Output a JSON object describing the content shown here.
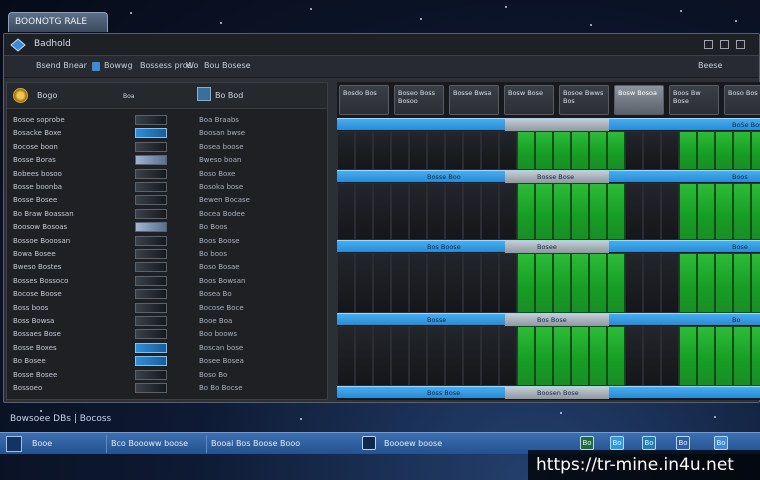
{
  "tab": {
    "label": "BOONOTG RALE"
  },
  "window": {
    "title": "Badhold",
    "toolbar": [
      "Bsend Bnear",
      "Bowwg",
      "Bossess pros",
      "Wo",
      "Bou Bosese"
    ],
    "toolbar_right": "Beese"
  },
  "left_panel": {
    "header": [
      {
        "name": "Bogo",
        "sub": "Boa"
      },
      {
        "name": "Bo Bod"
      }
    ],
    "rows": [
      {
        "label": "Bosoe soprobe",
        "meta": "Boa Braabs"
      },
      {
        "label": "Bosacke Boxe",
        "meta": "Boosan bwse"
      },
      {
        "label": "Bocose boon",
        "meta": "Bosea boose"
      },
      {
        "label": "Bosse Boras",
        "meta": "Bweso boan"
      },
      {
        "label": "Bobees bosoo",
        "meta": "Boso Boxe"
      },
      {
        "label": "Bosse boonba",
        "meta": "Bosoka bose"
      },
      {
        "label": "Bosse Bosee",
        "meta": "Bewen Bocase"
      },
      {
        "label": "Bo Braw Boassan",
        "meta": "Bocea Bodee"
      },
      {
        "label": "Boosow Bosoas",
        "meta": "Bo Boos"
      },
      {
        "label": "Bossoe Booosan",
        "meta": "Boos Boose"
      },
      {
        "label": "Bowa Bosee",
        "meta": "Bo boos"
      },
      {
        "label": "Bweso Bostes",
        "meta": "Boso Bosae"
      },
      {
        "label": "Bosses Bossoco",
        "meta": "Boos Bowsan"
      },
      {
        "label": "Bocose Boose",
        "meta": "Bosea Bo"
      },
      {
        "label": "Boss boos",
        "meta": "Bocose Boce"
      },
      {
        "label": "Boss Bowsa",
        "meta": "Booe Boa"
      },
      {
        "label": "Bossaes Bose",
        "meta": "Boo boows"
      },
      {
        "label": "Bosse Boxes",
        "meta": "Boscan bose"
      },
      {
        "label": "Bo Bosee",
        "meta": "Bosee Bosea"
      },
      {
        "label": "Bosse Bosee",
        "meta": "Boso Bo"
      },
      {
        "label": "Bossoeo",
        "meta": "Bo Bo Bocse"
      }
    ]
  },
  "right_panel": {
    "columns": [
      "Bosdo Bos",
      "Boseo Boss Bosoo",
      "Bosse Bwsa",
      "Bosw Bose",
      "Bosoe Bwws Bos",
      "Bosw Bosoa",
      "Boos Bw Bose",
      "Boso Bos",
      "Bo Bos"
    ],
    "bands": [
      {
        "left": "",
        "right": "BoSe Bose"
      },
      {
        "left": "Bosse Boo",
        "mid": "Bosse Bose",
        "right": "Boos"
      },
      {
        "left": "Bos Boose",
        "mid": "Bosee",
        "right": "Bose"
      },
      {
        "left": "Bosse",
        "mid": "Bos Bose",
        "right": "Bo"
      },
      {
        "left": "Boss Bose",
        "mid": "Boosen Bose",
        "right": ""
      }
    ]
  },
  "status_bar": {
    "text": "Bowsoee DBs | Bocoss"
  },
  "taskbar": {
    "start_label": "Booe",
    "items": [
      "Bco Boooww boose",
      "Booai Bos Boose Booo",
      "Boooew boose"
    ],
    "tray": [
      "Bo",
      "Bo",
      "Bo",
      "Bo",
      "Bo"
    ]
  },
  "watermark": {
    "text": "https://tr-mine.in4u.net"
  },
  "colors": {
    "accent_blue": "#2b8ad3",
    "grid_green": "#1a9d27",
    "panel_dark": "#1e2024",
    "taskbar": "#24518f"
  }
}
